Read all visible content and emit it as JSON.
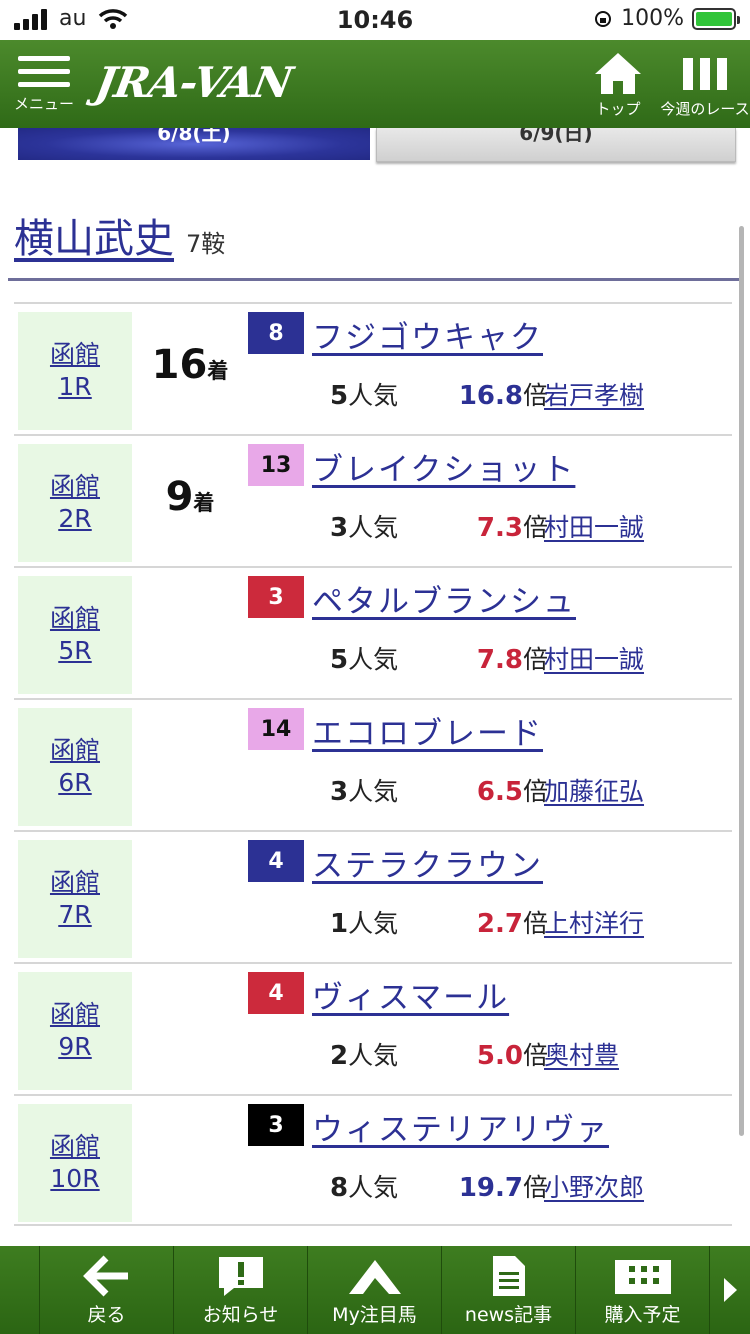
{
  "status": {
    "carrier": "au",
    "time": "10:46",
    "battery": "100%"
  },
  "header": {
    "menu_label": "メニュー",
    "logo": "JRA-VAN",
    "top_label": "トップ",
    "week_label": "今週のレース"
  },
  "date_tabs": [
    {
      "label": "6/8(土)"
    },
    {
      "label": "6/9(日)"
    }
  ],
  "jockey": {
    "name": "横山武史",
    "rides": "7鞍"
  },
  "rows": [
    {
      "venue": "函館",
      "race": "1R",
      "result": "16",
      "result_suffix": "着",
      "horse_no": "8",
      "no_color": "#2c3194",
      "no_text_color": "#ffffff",
      "horse": "フジゴウキャク",
      "pop": "5",
      "pop_suffix": "人気",
      "odds": "16.8",
      "odds_suffix": "倍",
      "jockey": "岩戸孝樹"
    },
    {
      "venue": "函館",
      "race": "2R",
      "result": "9",
      "result_suffix": "着",
      "horse_no": "13",
      "no_color": "#e8a8e8",
      "no_text_color": "#111111",
      "horse": "ブレイクショット",
      "pop": "3",
      "pop_suffix": "人気",
      "odds": "7.3",
      "odds_suffix": "倍",
      "jockey": "村田一誠"
    },
    {
      "venue": "函館",
      "race": "5R",
      "result": "",
      "result_suffix": "",
      "horse_no": "3",
      "no_color": "#cc2a3c",
      "no_text_color": "#ffffff",
      "horse": "ペタルブランシュ",
      "pop": "5",
      "pop_suffix": "人気",
      "odds": "7.8",
      "odds_suffix": "倍",
      "jockey": "村田一誠"
    },
    {
      "venue": "函館",
      "race": "6R",
      "result": "",
      "result_suffix": "",
      "horse_no": "14",
      "no_color": "#e8a8e8",
      "no_text_color": "#111111",
      "horse": "エコロブレード",
      "pop": "3",
      "pop_suffix": "人気",
      "odds": "6.5",
      "odds_suffix": "倍",
      "jockey": "加藤征弘"
    },
    {
      "venue": "函館",
      "race": "7R",
      "result": "",
      "result_suffix": "",
      "horse_no": "4",
      "no_color": "#2c3194",
      "no_text_color": "#ffffff",
      "horse": "ステラクラウン",
      "pop": "1",
      "pop_suffix": "人気",
      "odds": "2.7",
      "odds_suffix": "倍",
      "jockey": "上村洋行"
    },
    {
      "venue": "函館",
      "race": "9R",
      "result": "",
      "result_suffix": "",
      "horse_no": "4",
      "no_color": "#cc2a3c",
      "no_text_color": "#ffffff",
      "horse": "ヴィスマール",
      "pop": "2",
      "pop_suffix": "人気",
      "odds": "5.0",
      "odds_suffix": "倍",
      "jockey": "奥村豊"
    },
    {
      "venue": "函館",
      "race": "10R",
      "result": "",
      "result_suffix": "",
      "horse_no": "3",
      "no_color": "#000000",
      "no_text_color": "#ffffff",
      "horse": "ウィステリアリヴァ",
      "pop": "8",
      "pop_suffix": "人気",
      "odds": "19.7",
      "odds_suffix": "倍",
      "jockey": "小野次郎"
    }
  ],
  "bottom_bar": {
    "back": "戻る",
    "notice": "お知らせ",
    "my_watch": "My注目馬",
    "news": "news記事",
    "plan": "購入予定"
  }
}
